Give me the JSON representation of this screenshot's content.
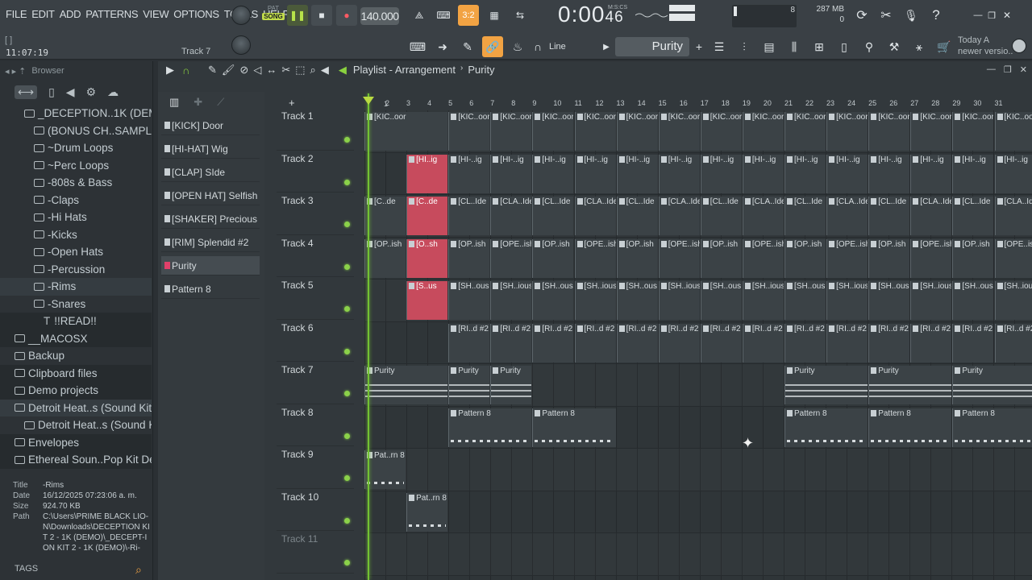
{
  "menu": [
    "FILE",
    "EDIT",
    "ADD",
    "PATTERNS",
    "VIEW",
    "OPTIONS",
    "TOOLS",
    "HELP"
  ],
  "transport": {
    "pat_label": "PAT",
    "song_label": "SONG",
    "tempo": "140.000",
    "time_main": "0:00",
    "time_sub": "46",
    "time_units": "M:S:CS"
  },
  "hint": "[ ]",
  "clock": "11:07:19",
  "current_track_hint": "Track 7",
  "memory": {
    "mb": "287 MB",
    "cpu_value": "8",
    "poly": "0"
  },
  "snap": "Line",
  "current_pattern": "Purity",
  "news": {
    "line1": "Today  A",
    "line2": "newer versio.."
  },
  "browser": {
    "title": "Browser",
    "tree": [
      {
        "label": "_DECEPTION..1K (DEMO)",
        "type": "open",
        "indent": 1,
        "style": "sub"
      },
      {
        "label": "(BONUS CH..SAMPLES)",
        "type": "folder",
        "indent": 2,
        "style": "sub"
      },
      {
        "label": "~Drum Loops",
        "type": "folder",
        "indent": 2,
        "style": "sub"
      },
      {
        "label": "~Perc Loops",
        "type": "folder",
        "indent": 2,
        "style": "sub"
      },
      {
        "label": "-808s & Bass",
        "type": "folder",
        "indent": 2,
        "style": "sub"
      },
      {
        "label": "-Claps",
        "type": "folder",
        "indent": 2,
        "style": "sub"
      },
      {
        "label": "-Hi Hats",
        "type": "folder",
        "indent": 2,
        "style": "sub"
      },
      {
        "label": "-Kicks",
        "type": "folder",
        "indent": 2,
        "style": "sub"
      },
      {
        "label": "-Open Hats",
        "type": "folder",
        "indent": 2,
        "style": "sub"
      },
      {
        "label": "-Percussion",
        "type": "folder",
        "indent": 2,
        "style": "sub"
      },
      {
        "label": "-Rims",
        "type": "folder",
        "indent": 2,
        "style": "hl"
      },
      {
        "label": "-Snares",
        "type": "folder",
        "indent": 2,
        "style": "sub"
      },
      {
        "label": "!!READ!!",
        "type": "text",
        "indent": 3,
        "style": "dark"
      },
      {
        "label": "__MACOSX",
        "type": "folder",
        "indent": 0,
        "style": "dark"
      },
      {
        "label": "Backup",
        "type": "folder",
        "indent": 0,
        "style": "sub"
      },
      {
        "label": "Clipboard files",
        "type": "folder",
        "indent": 0,
        "style": "dark"
      },
      {
        "label": "Demo projects",
        "type": "folder",
        "indent": 0,
        "style": "dark"
      },
      {
        "label": "Detroit Heat..s (Sound Kit)",
        "type": "folder",
        "indent": 0,
        "style": "hl"
      },
      {
        "label": "Detroit Heat..s (Sound Kit)",
        "type": "folder",
        "indent": 1,
        "style": "sub"
      },
      {
        "label": "Envelopes",
        "type": "folder",
        "indent": 0,
        "style": "dark"
      },
      {
        "label": "Ethereal Soun..Pop Kit Demo",
        "type": "folder",
        "indent": 0,
        "style": "dark"
      }
    ],
    "info": {
      "title_k": "Title",
      "title_v": "-Rims",
      "date_k": "Date",
      "date_v": "16/12/2025 07:23:06 a. m.",
      "size_k": "Size",
      "size_v": "924.70 KB",
      "path_k": "Path",
      "path_v": "C:\\Users\\PRIME BLACK LIO-N\\Downloads\\DECEPTION KIT 2 - 1K (DEMO)\\_DECEPT-ION KIT 2 - 1K (DEMO)\\-Ri-"
    },
    "tags_label": "TAGS"
  },
  "playlist": {
    "title_prefix": "Playlist - Arrangement",
    "title_pattern": "Purity",
    "patterns": [
      "[KICK] Door",
      "[HI-HAT] Wig",
      "[CLAP] SIde",
      "[OPEN HAT] Selfish",
      "[SHAKER] Precious",
      "[RIM] Splendid #2",
      "Purity",
      "Pattern 8"
    ],
    "selected_pattern_index": 6,
    "ruler": [
      "2",
      "3",
      "4",
      "5",
      "6",
      "7",
      "8",
      "9",
      "10",
      "11",
      "12",
      "13",
      "14",
      "15",
      "16",
      "17",
      "18",
      "19",
      "20",
      "21",
      "22",
      "23",
      "24",
      "25",
      "26",
      "27",
      "28",
      "29",
      "30",
      "31"
    ],
    "tracks": [
      "Track 1",
      "Track 2",
      "Track 3",
      "Track 4",
      "Track 5",
      "Track 6",
      "Track 7",
      "Track 8",
      "Track 9",
      "Track 10",
      "Track 11"
    ],
    "clip_names": {
      "kick": "[KIC..oor",
      "kick_first": "[KIC..oor",
      "hat": "[HI-..ig",
      "hat_first": "[HI..ig",
      "clap1": "[CL..Ide",
      "clap2": "[CLA..Ide",
      "clap_first": "[C..de",
      "ohat1": "[OP..ish",
      "ohat2": "[OPE..ish",
      "ohat_first": "[O..sh",
      "shk1": "[SH..ous",
      "shk2": "[SH..ious",
      "shk_first": "[S..us",
      "rim": "[RI..d #2",
      "purity": "Purity",
      "p8": "Pattern 8",
      "p8_short": "Pat..rn 8"
    }
  },
  "colors": {
    "accent": "#f2a343",
    "playhead": "#73c232",
    "clip_red": "#c74b5d",
    "song": "#c2db4a"
  }
}
